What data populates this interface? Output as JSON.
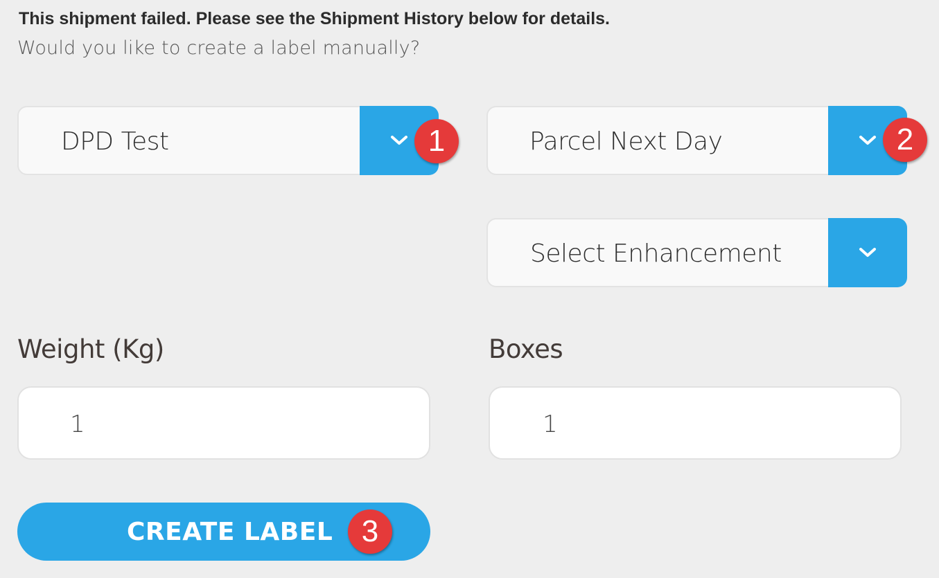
{
  "message": {
    "error": "This shipment failed. Please see the Shipment History below for details.",
    "question": "Would you like to create a label manually?"
  },
  "form": {
    "carrier": {
      "value": "DPD Test",
      "toggle_icon": "chevron-down-icon",
      "badge": "1"
    },
    "service": {
      "value": "Parcel Next Day",
      "toggle_icon": "chevron-down-icon",
      "badge": "2"
    },
    "enhancement": {
      "value": "Select Enhancement",
      "toggle_icon": "chevron-down-icon"
    },
    "weight": {
      "label": "Weight (Kg)",
      "value": "1"
    },
    "boxes": {
      "label": "Boxes",
      "value": "1"
    },
    "submit": {
      "label": "CREATE LABEL",
      "badge": "3"
    }
  },
  "colors": {
    "background": "#eeeeee",
    "accent": "#2aa6e6",
    "badge": "#e53a3a",
    "field": "#ffffff"
  }
}
